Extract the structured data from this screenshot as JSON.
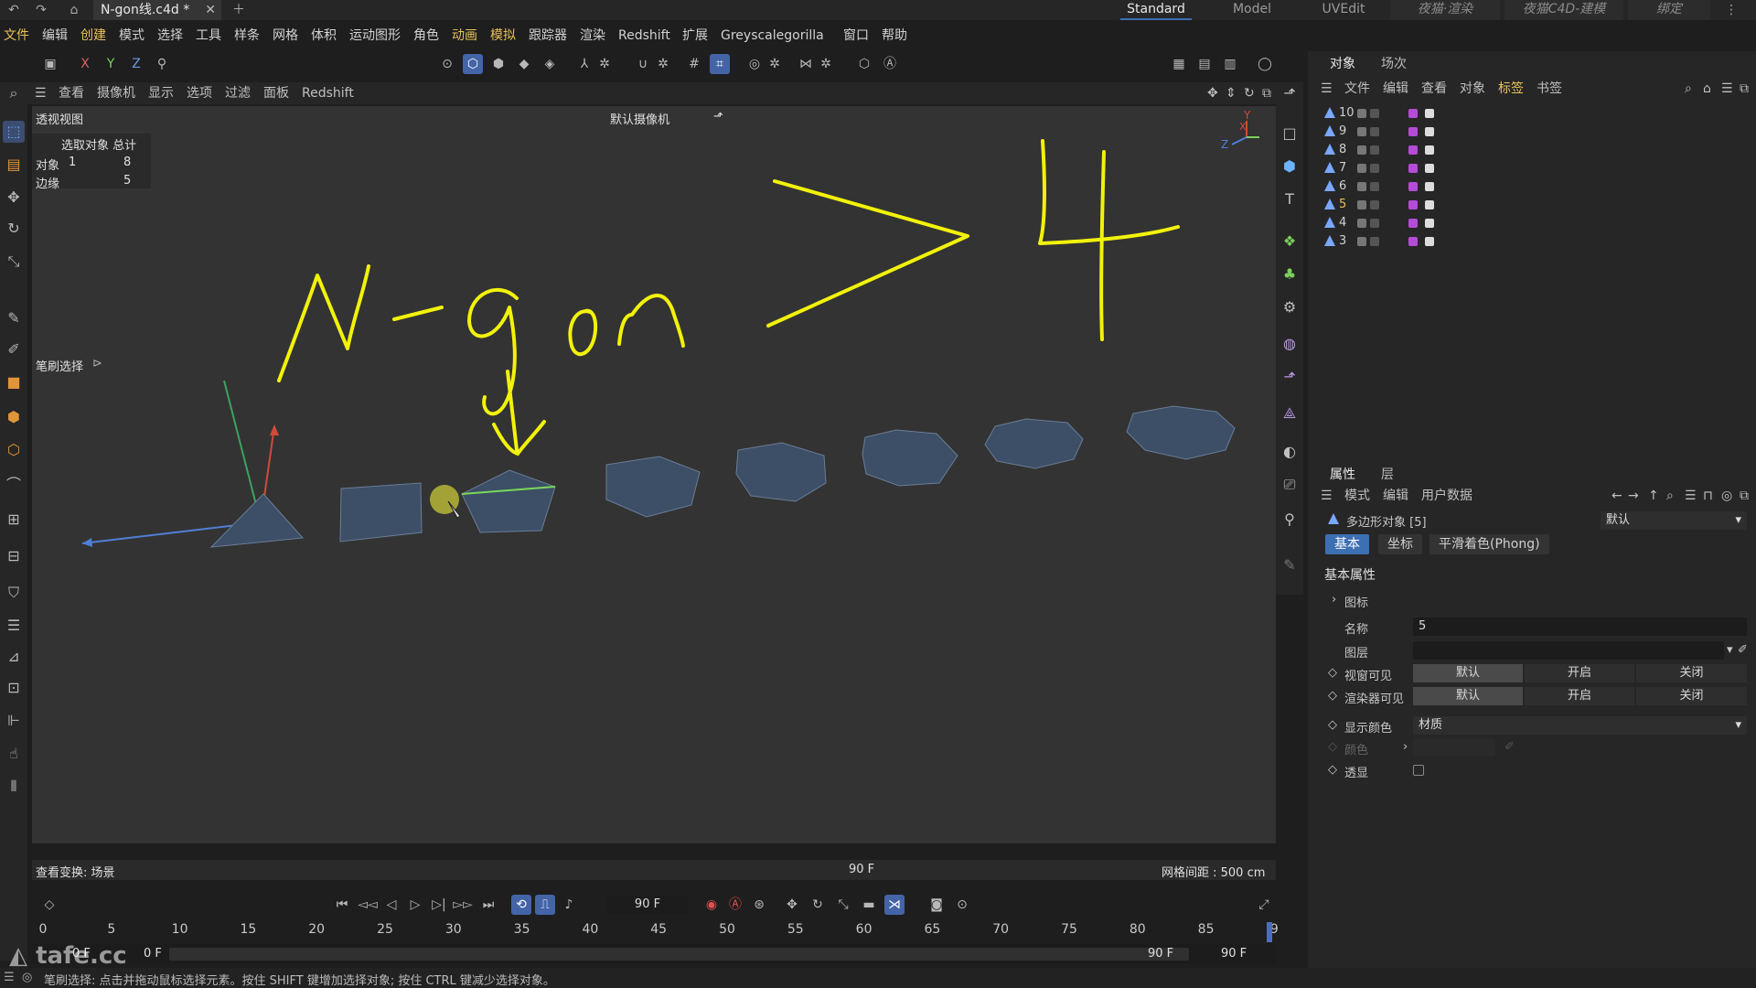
{
  "titlebar": {
    "doc_tab": "N-gon线.c4d *",
    "layouts": [
      "Standard",
      "Model",
      "UVEdit",
      "夜猫·渲染",
      "夜猫C4D-建模",
      "绑定"
    ]
  },
  "menubar": [
    "文件",
    "编辑",
    "创建",
    "模式",
    "选择",
    "工具",
    "样条",
    "网格",
    "体积",
    "运动图形",
    "角色",
    "动画",
    "模拟",
    "跟踪器",
    "渲染",
    "Redshift",
    "扩展",
    "Greyscalegorilla",
    "窗口",
    "帮助"
  ],
  "toolbar": {
    "axis_x": "X",
    "axis_y": "Y",
    "axis_z": "Z"
  },
  "viewport": {
    "menu": [
      "查看",
      "摄像机",
      "显示",
      "选项",
      "过滤",
      "面板",
      "Redshift"
    ],
    "title": "透视视图",
    "camera": "默认摄像机",
    "stats_header": "选取对象 总计",
    "stats": [
      {
        "label": "对象",
        "sel": "1",
        "total": "8"
      },
      {
        "label": "边缘",
        "sel": "",
        "total": "5"
      }
    ],
    "brush_label": "笔刷选择",
    "annotation": "N-gon > 4",
    "status_left": "查看变换: 场景",
    "status_center": "90 F",
    "status_right": "网格间距 : 500 cm"
  },
  "object_manager": {
    "tabs": [
      "对象",
      "场次"
    ],
    "menu": [
      "文件",
      "编辑",
      "查看",
      "对象",
      "标签",
      "书签"
    ],
    "objects": [
      "10",
      "9",
      "8",
      "7",
      "6",
      "5",
      "4",
      "3"
    ],
    "selected": "5"
  },
  "attributes": {
    "tabs": [
      "属性",
      "层"
    ],
    "menu": [
      "模式",
      "编辑",
      "用户数据"
    ],
    "object_title": "多边形对象 [5]",
    "preset": "默认",
    "subtabs": [
      "基本",
      "坐标",
      "平滑着色(Phong)"
    ],
    "section": "基本属性",
    "icon_group": "图标",
    "name_label": "名称",
    "name_value": "5",
    "layer_label": "图层",
    "editor_vis_label": "视窗可见",
    "render_vis_label": "渲染器可见",
    "vis_options": [
      "默认",
      "开启",
      "关闭"
    ],
    "display_color_label": "显示颜色",
    "display_color_value": "材质",
    "color_label": "颜色",
    "xray_label": "透显"
  },
  "timeline": {
    "frame_field": "90 F",
    "ticks": [
      "0",
      "5",
      "10",
      "15",
      "20",
      "25",
      "30",
      "35",
      "40",
      "45",
      "50",
      "55",
      "60",
      "65",
      "70",
      "75",
      "80",
      "85",
      "9"
    ],
    "range_start_a": "0 F",
    "range_start_b": "0 F",
    "range_end_a": "90 F",
    "range_end_b": "90 F"
  },
  "statusbar": "笔刷选择: 点击并拖动鼠标选择元素。按住 SHIFT 键增加选择对象; 按住 CTRL 键减少选择对象。",
  "watermark": "tafe.cc"
}
